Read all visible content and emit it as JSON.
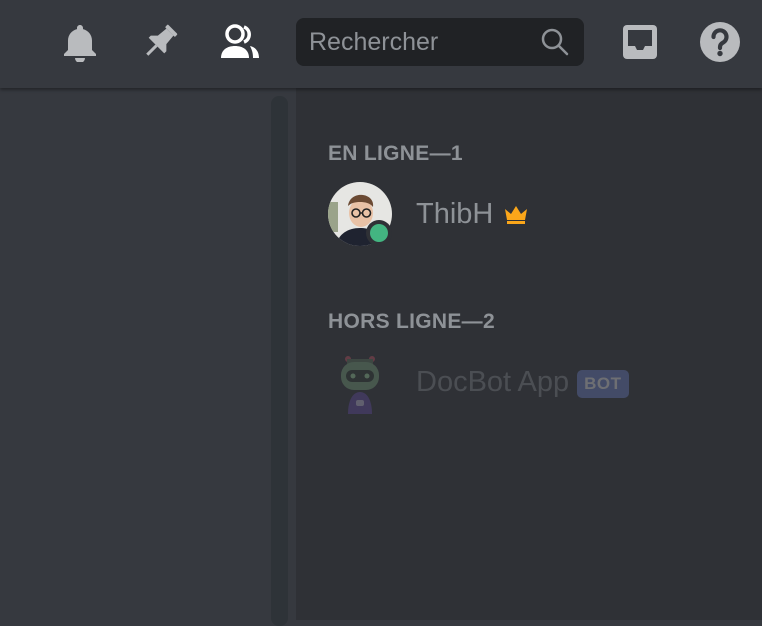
{
  "header": {
    "icons": {
      "notifications": "bell-icon",
      "pinned": "pin-icon",
      "member_list": "members-icon",
      "inbox": "inbox-icon",
      "help": "help-icon"
    },
    "search": {
      "placeholder": "Rechercher",
      "value": "",
      "icon": "search-icon"
    }
  },
  "member_list": {
    "groups": [
      {
        "header": "EN LIGNE—1",
        "members": [
          {
            "name": "ThibH",
            "status": "online",
            "status_color": "#43b581",
            "badge_icon": "crown-icon",
            "badge_color": "#faa61a"
          }
        ]
      },
      {
        "header": "HORS LIGNE—2",
        "members": [
          {
            "name": "DocBot App",
            "tag": "BOT",
            "tag_color": "#7289da"
          }
        ]
      }
    ]
  },
  "colors": {
    "background": "#36393f",
    "panel": "#2f3136",
    "search_bg": "#202225",
    "text_muted": "#8e9297"
  }
}
